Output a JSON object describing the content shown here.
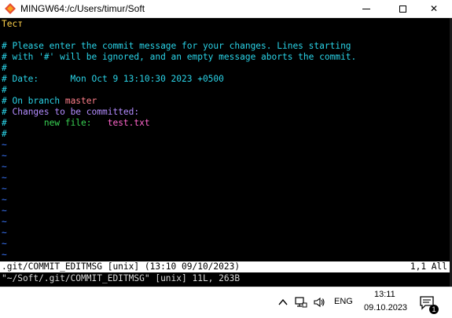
{
  "window": {
    "title": "MINGW64:/c/Users/timur/Soft",
    "icon": "git-bash-icon",
    "buttons": {
      "minimize": "minimize-icon",
      "maximize": "maximize-icon",
      "close": "✕"
    }
  },
  "editor": {
    "lines": [
      {
        "text": "Тест",
        "color": "#ffd24a"
      },
      {
        "text": "",
        "color": "#2ad3e7"
      },
      {
        "text": "# Please enter the commit message for your changes. Lines starting",
        "color": "#2ad3e7"
      },
      {
        "text": "# with '#' will be ignored, and an empty message aborts the commit.",
        "color": "#2ad3e7"
      },
      {
        "text": "#",
        "color": "#2ad3e7"
      },
      {
        "text": "# Date:      Mon Oct 9 13:10:30 2023 +0500",
        "color": "#2ad3e7"
      },
      {
        "text": "#",
        "color": "#2ad3e7"
      },
      {
        "text": "# On branch ",
        "color": "#2ad3e7",
        "extra": "master",
        "extra_color": "#ff7f8a"
      },
      {
        "text": "# ",
        "color": "#2ad3e7",
        "extra": "Changes to be committed:",
        "extra_color": "#b38cff"
      },
      {
        "text": "#       ",
        "color": "#2ad3e7",
        "extra": "new file:",
        "extra_color": "#39d353",
        "extra2": "   test.txt",
        "extra2_color": "#ff66cc"
      },
      {
        "text": "#",
        "color": "#2ad3e7"
      }
    ],
    "tilde_lines": [
      "~",
      "~",
      "~",
      "~",
      "~",
      "~",
      "~",
      "~",
      "~",
      "~",
      "~"
    ],
    "status_left": ".git/COMMIT_EDITMSG [unix] (13:10 09/10/2023)",
    "status_right": "1,1 All",
    "command_line": "\"~/Soft/.git/COMMIT_EDITMSG\" [unix] 11L, 263B"
  },
  "taskbar": {
    "language": "ENG",
    "time": "13:11",
    "date": "09.10.2023",
    "notification_count": "1",
    "icons": [
      "chevron-up-icon",
      "network-icon",
      "volume-icon",
      "notification-icon"
    ]
  }
}
